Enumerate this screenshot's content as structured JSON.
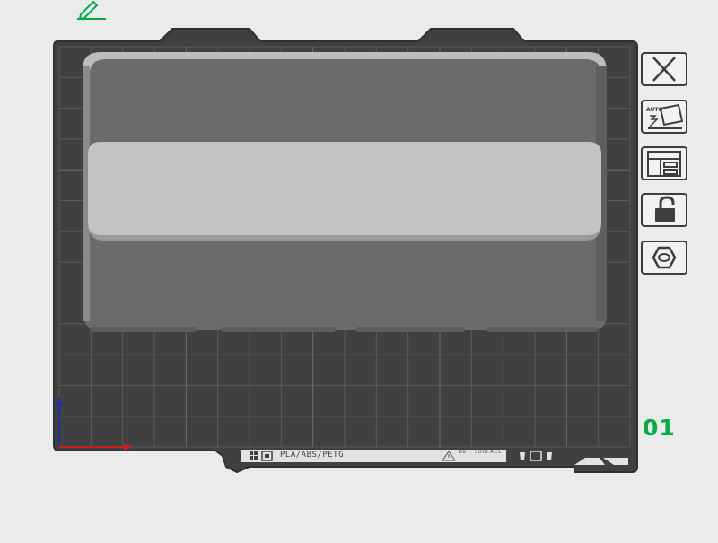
{
  "plate": {
    "number": "01",
    "filament_compat": "PLA/ABS/PETG",
    "hot_surface_text": "HOT SURFACE",
    "grid_columns": 18,
    "grid_rows": 13
  },
  "colors": {
    "background": "#ebebeb",
    "plate": "#3f4141",
    "plate_edge": "#2f3131",
    "grid_line": "#5a5c5c",
    "accent_green": "#00ae42",
    "label_bar": "#e2e2e2",
    "axis_x": "#c8201e",
    "axis_y": "#1f2fa8",
    "model_body": "#6b6b6b",
    "model_highlight": "#c3c3c3"
  },
  "toolbar": {
    "items": [
      {
        "id": "delete-plate",
        "icon": "close-icon"
      },
      {
        "id": "auto-orient",
        "icon": "auto-orient-icon",
        "label": "AUTO"
      },
      {
        "id": "arrange",
        "icon": "arrange-layout-icon"
      },
      {
        "id": "lock-plate",
        "icon": "unlock-icon"
      },
      {
        "id": "plate-settings",
        "icon": "hexagon-settings-icon"
      }
    ]
  },
  "top_left": {
    "icon": "pencil-edit-icon"
  },
  "axes": {
    "x_icon": "x-axis-arrow",
    "y_icon": "y-axis-arrow"
  }
}
